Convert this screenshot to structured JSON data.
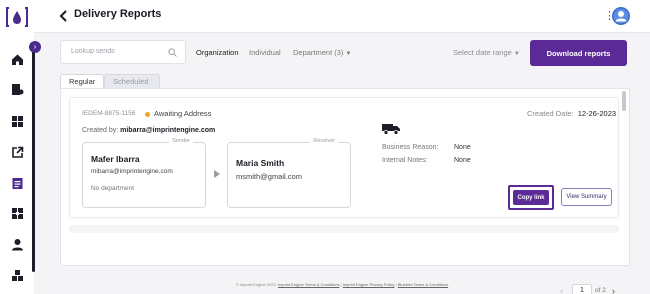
{
  "header": {
    "title": "Delivery Reports"
  },
  "sidebar": {
    "items": [
      {
        "name": "home-icon"
      },
      {
        "name": "sends-icon"
      },
      {
        "name": "dashboard-icon"
      },
      {
        "name": "external-link-icon"
      },
      {
        "name": "reports-icon",
        "active": true
      },
      {
        "name": "integrations-icon"
      },
      {
        "name": "user-icon"
      },
      {
        "name": "inventory-icon"
      }
    ]
  },
  "toolbar": {
    "search_placeholder": "Lookup sends",
    "filters": [
      "Organization",
      "Individual",
      "Department (3)"
    ],
    "date_range": "Select date range",
    "download_label": "Download reports"
  },
  "tabs": [
    "Regular",
    "Scheduled"
  ],
  "card": {
    "code": "IEDEM-8875-1156",
    "status": "Awaiting Address",
    "created_by_label": "Created by:",
    "created_by": "mibarra@imprintengine.com",
    "created_date_label": "Created Date:",
    "created_date": "12-26-2023",
    "sender": {
      "legend": "Sender",
      "name": "Mafer Ibarra",
      "email": "mibarra@imprintengine.com",
      "department": "No department"
    },
    "receiver": {
      "legend": "Receiver",
      "name": "Maria Smith",
      "email": "msmith@gmail.com"
    },
    "business_reason_label": "Business Reason:",
    "business_reason": "None",
    "internal_notes_label": "Internal Notes:",
    "internal_notes": "None",
    "copy_link_label": "Copy link",
    "view_summary_label": "View Summary"
  },
  "pagination": {
    "current": "1",
    "total_label": "of 2"
  },
  "footer": {
    "copyright": "© Imprint Engine 2023.",
    "links": [
      "Imprint Engine Terms & Conditions",
      "Imprint Engine Privacy Policy",
      "Bluebird Terms & Conditions"
    ]
  },
  "colors": {
    "accent": "#5b2a96",
    "status_pending": "#f0a52a"
  }
}
